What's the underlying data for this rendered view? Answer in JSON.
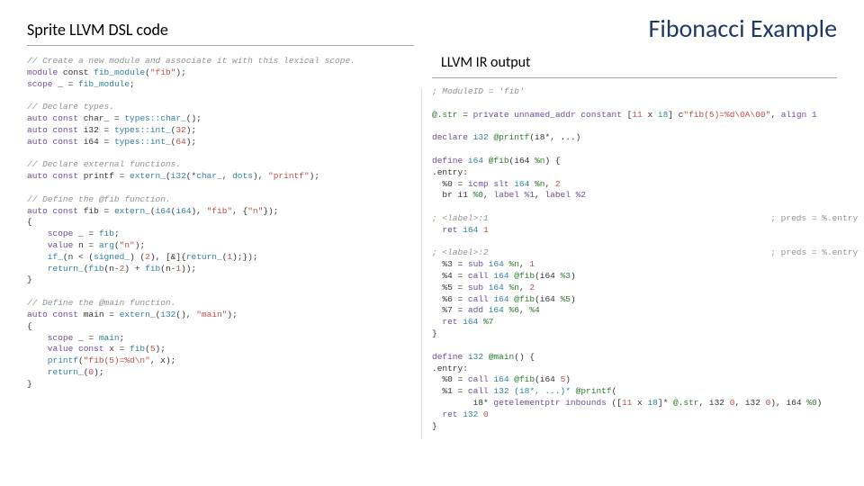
{
  "slide": {
    "title": "Fibonacci Example",
    "left_heading": "Sprite LLVM DSL code",
    "mid_heading": "LLVM IR output"
  },
  "dsl": {
    "c1": "// Create a new module and associate it with this lexical scope.",
    "l1a": "module",
    "l1b": " const ",
    "l1c": "fib_module",
    "l1d": "(",
    "l1e": "\"fib\"",
    "l1f": ");",
    "l2a": "scope",
    "l2b": " _ = ",
    "l2c": "fib_module",
    "l2d": ";",
    "c2": "// Declare types.",
    "l3a": "auto const ",
    "l3b": "char_",
    "l3c": " = ",
    "l3d": "types::char_",
    "l3e": "();",
    "l4a": "auto const ",
    "l4b": "i32",
    "l4c": " = ",
    "l4d": "types::int_",
    "l4e": "(",
    "l4n": "32",
    "l4f": ");",
    "l5a": "auto const ",
    "l5b": "i64",
    "l5c": " = ",
    "l5d": "types::int_",
    "l5e": "(",
    "l5n": "64",
    "l5f": ");",
    "c3": "// Declare external functions.",
    "l6a": "auto const ",
    "l6b": "printf",
    "l6c": " = ",
    "l6d": "extern_",
    "l6e": "(",
    "l6f": "i32",
    "l6g": "(*",
    "l6h": "char_",
    "l6i": ", ",
    "l6j": "dots",
    "l6k": "), ",
    "l6s": "\"printf\"",
    "l6l": ");",
    "c4": "// Define the @fib function.",
    "l7a": "auto const ",
    "l7b": "fib",
    "l7c": " = ",
    "l7d": "extern_",
    "l7e": "(",
    "l7f": "i64",
    "l7g": "(",
    "l7h": "i64",
    "l7i": "), ",
    "l7s1": "\"fib\"",
    "l7j": ", {",
    "l7s2": "\"n\"",
    "l7k": "});",
    "l8": "{",
    "l9a": "    scope",
    "l9b": " _ = ",
    "l9c": "fib",
    "l9d": ";",
    "l10a": "    value",
    "l10b": " n = ",
    "l10c": "arg",
    "l10d": "(",
    "l10e": "\"n\"",
    "l10f": ");",
    "l11a": "    if_",
    "l11b": "(n < (",
    "l11c": "signed_",
    "l11d": ") (",
    "l11n": "2",
    "l11e": "), [&]{",
    "l11f": "return_",
    "l11g": "(",
    "l11h": "1",
    "l11i": ");});",
    "l12a": "    return_",
    "l12b": "(",
    "l12c": "fib",
    "l12d": "(n-",
    "l12n1": "2",
    "l12e": ") + ",
    "l12f": "fib",
    "l12g": "(n-",
    "l12n2": "1",
    "l12h": "));",
    "l13": "}",
    "c5": "// Define the @main function.",
    "l14a": "auto const ",
    "l14b": "main",
    "l14c": " = ",
    "l14d": "extern_",
    "l14e": "(",
    "l14f": "i32",
    "l14g": "(), ",
    "l14s": "\"main\"",
    "l14h": ");",
    "l15": "{",
    "l16a": "    scope",
    "l16b": " _ = ",
    "l16c": "main",
    "l16d": ";",
    "l17a": "    value const ",
    "l17b": "x",
    "l17c": " = ",
    "l17d": "fib",
    "l17e": "(",
    "l17n": "5",
    "l17f": ");",
    "l18a": "    printf",
    "l18b": "(",
    "l18s": "\"fib(5)=%d\\n\"",
    "l18c": ", x);",
    "l19a": "    return_",
    "l19b": "(",
    "l19n": "0",
    "l19c": ");",
    "l20": "}"
  },
  "ir": {
    "c1": "; ModuleID = 'fib'",
    "l1a": "@.str",
    "l1b": " = ",
    "l1c": "private unnamed_addr constant",
    "l1d": " [",
    "l1n1": "11",
    "l1e": " x ",
    "l1n2": "i8",
    "l1f": "] c",
    "l1s": "\"fib(5)=%d\\0A\\00\"",
    "l1g": ", ",
    "l1h": "align 1",
    "l2a": "declare",
    "l2b": " i32 ",
    "l2c": "@printf",
    "l2d": "(i8*, ...)",
    "l3a": "define",
    "l3b": " i64 ",
    "l3c": "@fib",
    "l3d": "(i64 ",
    "l3e": "%n",
    "l3f": ") {",
    "l4": ".entry:",
    "l5a": "  %0 = ",
    "l5b": "icmp slt",
    "l5c": " i64 ",
    "l5d": "%n",
    "l5e": ", ",
    "l5n": "2",
    "l6a": "  br i1 ",
    "l6b": "%0",
    "l6c": ", ",
    "l6d": "label %1",
    "l6e": ", ",
    "l6f": "label %2",
    "l7a": "; <label>:1",
    "l7p": "                                                       ; preds = %.entry",
    "l8a": "  ret",
    "l8b": " i64 ",
    "l8n": "1",
    "l9a": "; <label>:2",
    "l9p": "                                                       ; preds = %.entry",
    "l10a": "  %3 = ",
    "l10b": "sub",
    "l10c": " i64 ",
    "l10d": "%n",
    "l10e": ", ",
    "l10n": "1",
    "l11a": "  %4 = ",
    "l11b": "call",
    "l11c": " i64 ",
    "l11d": "@fib",
    "l11e": "(i64 ",
    "l11f": "%3",
    "l11g": ")",
    "l12a": "  %5 = ",
    "l12b": "sub",
    "l12c": " i64 ",
    "l12d": "%n",
    "l12e": ", ",
    "l12n": "2",
    "l13a": "  %6 = ",
    "l13b": "call",
    "l13c": " i64 ",
    "l13d": "@fib",
    "l13e": "(i64 ",
    "l13f": "%5",
    "l13g": ")",
    "l14a": "  %7 = ",
    "l14b": "add",
    "l14c": " i64 ",
    "l14d": "%6",
    "l14e": ", ",
    "l14f": "%4",
    "l15a": "  ret",
    "l15b": " i64 ",
    "l15c": "%7",
    "l16": "}",
    "l17a": "define",
    "l17b": " i32 ",
    "l17c": "@main",
    "l17d": "() {",
    "l18": ".entry:",
    "l19a": "  %0 = ",
    "l19b": "call",
    "l19c": " i64 ",
    "l19d": "@fib",
    "l19e": "(i64 ",
    "l19n": "5",
    "l19f": ")",
    "l20a": "  %1 = ",
    "l20b": "call",
    "l20c": " i32 (i8*, ...)* ",
    "l20d": "@printf",
    "l20e": "(",
    "l21a": "        i8* ",
    "l21b": "getelementptr inbounds",
    "l21c": " ([",
    "l21n1": "11",
    "l21d": " x ",
    "l21n2": "i8",
    "l21e": "]* ",
    "l21f": "@.str",
    "l21g": ", i32 ",
    "l21n3": "0",
    "l21h": ", i32 ",
    "l21n4": "0",
    "l21i": "), i64 ",
    "l21j": "%0",
    "l21k": ")",
    "l22a": "  ret",
    "l22b": " i32 ",
    "l22n": "0",
    "l23": "}"
  }
}
